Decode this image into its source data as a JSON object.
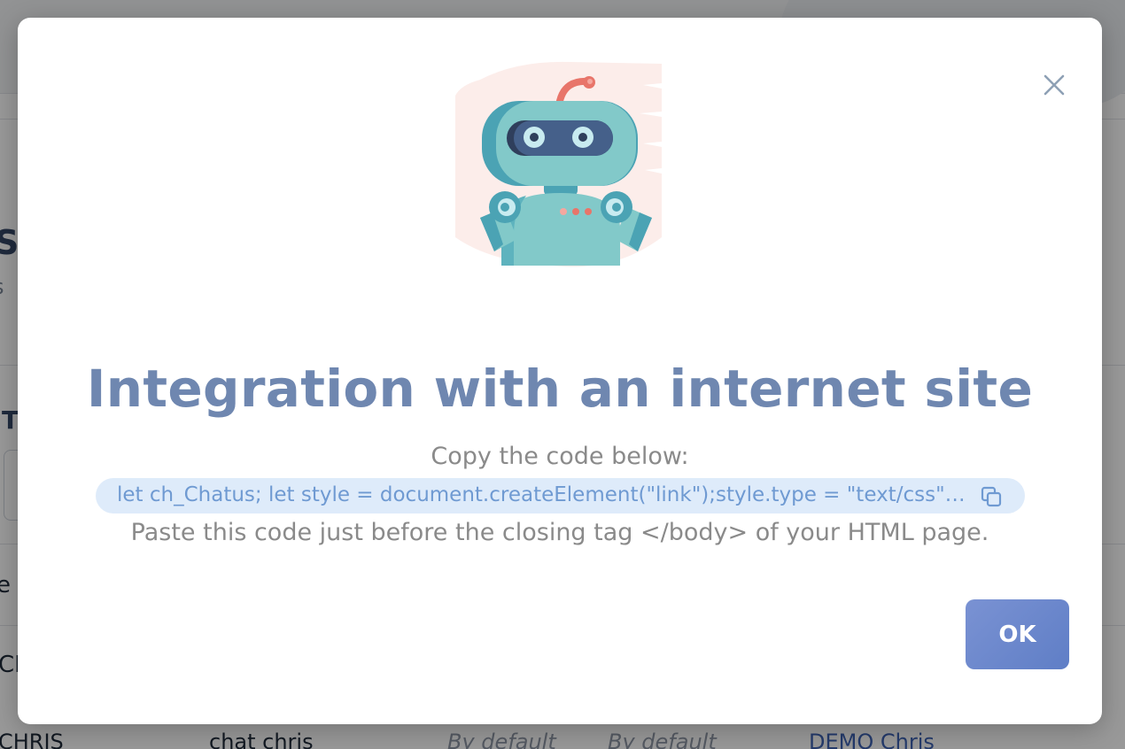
{
  "background": {
    "title_fragment": "S",
    "subtitle_fragment": "s",
    "section_fragment": "T",
    "column_fragment": "e",
    "row_fragment": "CE",
    "row": {
      "name": "CHRIS",
      "chat": "chat chris",
      "default_1": "By default",
      "default_2": "By default",
      "link": "DEMO Chris"
    }
  },
  "modal": {
    "close_icon": "close-icon",
    "illustration": "robot-illustration",
    "title": "Integration with an internet site",
    "copy_instruction": "Copy the code below:",
    "code_snippet": "let ch_Chatus; let style = document.createElement(\"link\");style.type = \"text/css\";style.rel = \"stylesheet\";",
    "copy_icon": "copy-icon",
    "paste_instruction": "Paste this code just before the closing tag </body> of your HTML page.",
    "ok_label": "OK"
  },
  "colors": {
    "title": "#6f87b0",
    "code_background": "#deebfa",
    "code_text": "#6f9ad2",
    "ok_button": "#6b87cc",
    "robot_teal": "#82c9c9",
    "robot_antenna": "#e8756a"
  }
}
